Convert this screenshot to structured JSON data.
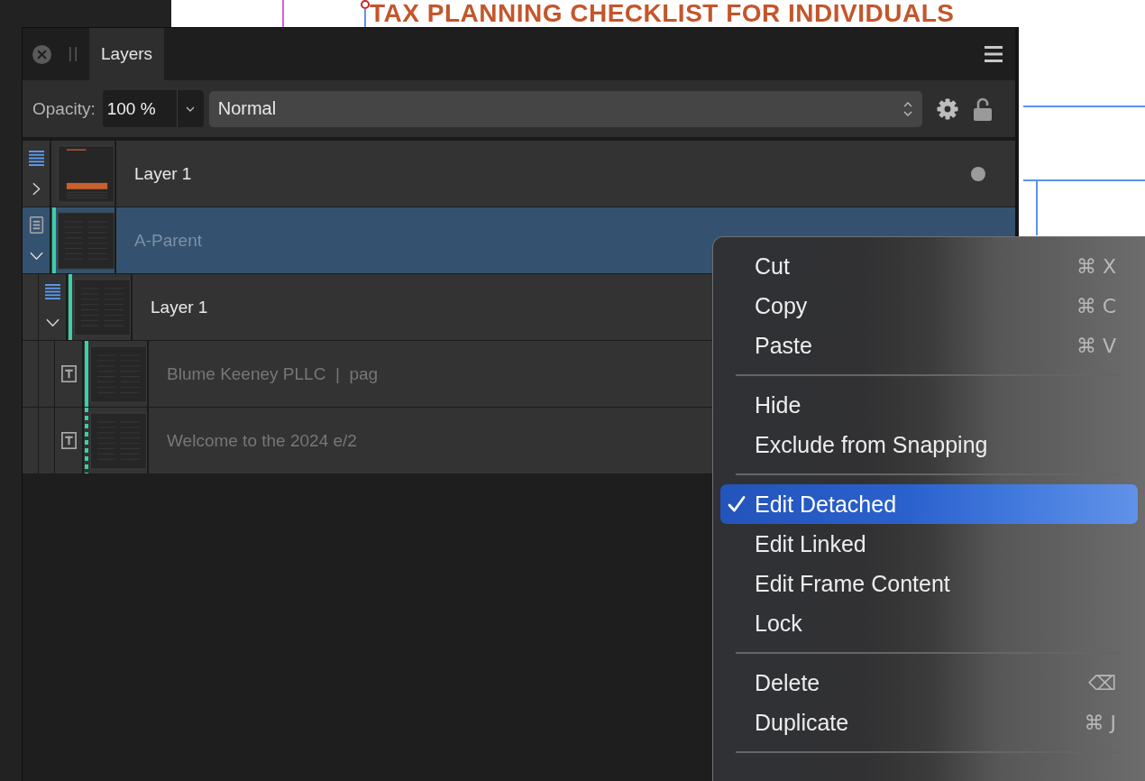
{
  "document": {
    "title": "TAX PLANNING CHECKLIST FOR INDIVIDUALS"
  },
  "panel": {
    "tabs": [
      {
        "label": "Layers",
        "selected": true
      }
    ],
    "opacity": {
      "label": "Opacity:",
      "value": "100 %"
    },
    "blend_mode": {
      "value": "Normal"
    }
  },
  "layers": [
    {
      "name": "Layer 1",
      "kind": "layer",
      "selected": false,
      "expanded": false,
      "dimmed": false,
      "visibility_dot": true,
      "link_bar": false
    },
    {
      "name": "A-Parent",
      "kind": "master",
      "selected": true,
      "expanded": true,
      "dimmed": true,
      "link_bar": true,
      "link_dashed": false,
      "children": [
        {
          "name": "Layer 1",
          "kind": "layer",
          "selected": false,
          "expanded": true,
          "dimmed": false,
          "link_bar": true,
          "link_dashed": false,
          "children": [
            {
              "name": "Blume Keeney PLLC  |  pag",
              "kind": "text",
              "selected": false,
              "dimmed": true,
              "link_bar": true,
              "link_dashed": false
            },
            {
              "name": "Welcome to the 2024 e/2",
              "kind": "text",
              "selected": false,
              "dimmed": true,
              "link_bar": true,
              "link_dashed": true
            }
          ]
        }
      ]
    }
  ],
  "context_menu": {
    "items": [
      {
        "kind": "item",
        "label": "Cut",
        "shortcut": "⌘ X",
        "checked": false,
        "selected": false
      },
      {
        "kind": "item",
        "label": "Copy",
        "shortcut": "⌘ C",
        "checked": false,
        "selected": false
      },
      {
        "kind": "item",
        "label": "Paste",
        "shortcut": "⌘ V",
        "checked": false,
        "selected": false
      },
      {
        "kind": "separator"
      },
      {
        "kind": "item",
        "label": "Hide",
        "checked": false,
        "selected": false
      },
      {
        "kind": "item",
        "label": "Exclude from Snapping",
        "checked": false,
        "selected": false
      },
      {
        "kind": "separator"
      },
      {
        "kind": "item",
        "label": "Edit Detached",
        "checked": true,
        "selected": true
      },
      {
        "kind": "item",
        "label": "Edit Linked",
        "checked": false,
        "selected": false
      },
      {
        "kind": "item",
        "label": "Edit Frame Content",
        "checked": false,
        "selected": false
      },
      {
        "kind": "item",
        "label": "Lock",
        "checked": false,
        "selected": false
      },
      {
        "kind": "separator"
      },
      {
        "kind": "item",
        "label": "Delete",
        "shortcut": "⌫",
        "checked": false,
        "selected": false
      },
      {
        "kind": "item",
        "label": "Duplicate",
        "shortcut": "⌘ J",
        "checked": false,
        "selected": false
      },
      {
        "kind": "separator"
      }
    ]
  }
}
